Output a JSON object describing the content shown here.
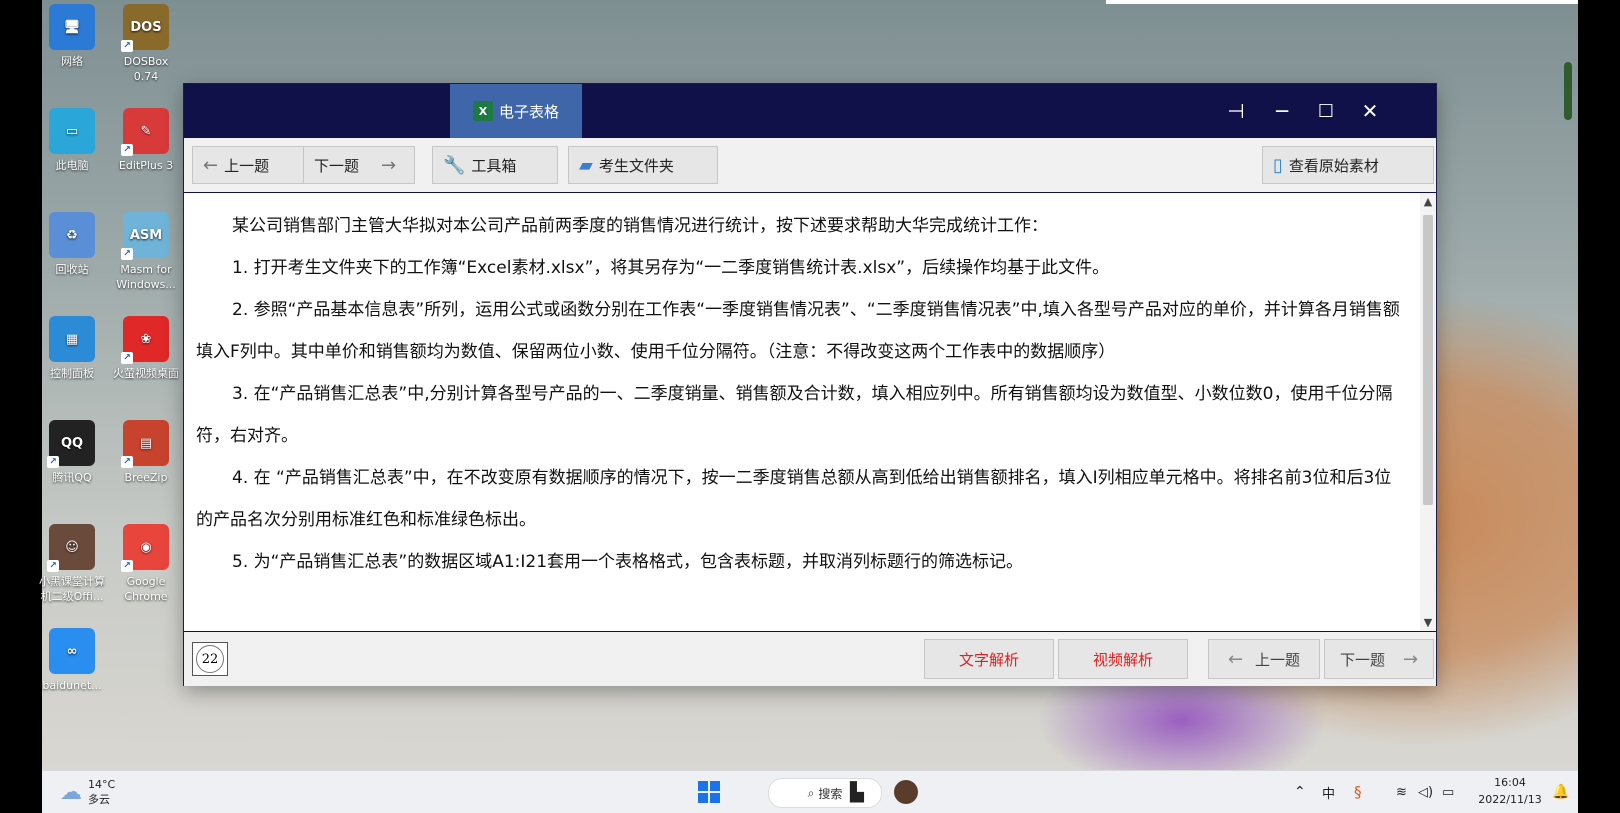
{
  "desktop": {
    "icons": [
      {
        "label": "网络",
        "glyph": "🖥",
        "color": "#2b7bd6"
      },
      {
        "label": "DOSBox 0.74",
        "glyph": "DOS",
        "color": "#8a6a2a"
      },
      {
        "label": "此电脑",
        "glyph": "▭",
        "color": "#2aa7d8"
      },
      {
        "label": "EditPlus 3",
        "glyph": "✎",
        "color": "#d83a3a"
      },
      {
        "label": "回收站",
        "glyph": "♻",
        "color": "#5a8ed6"
      },
      {
        "label": "Masm for Windows...",
        "glyph": "ASM",
        "color": "#6fb4d8"
      },
      {
        "label": "控制面板",
        "glyph": "▦",
        "color": "#2c8bd6"
      },
      {
        "label": "火萤视频桌面",
        "glyph": "❀",
        "color": "#e02828"
      },
      {
        "label": "腾讯QQ",
        "glyph": "QQ",
        "color": "#222222"
      },
      {
        "label": "BreeZip",
        "glyph": "▤",
        "color": "#c8432d"
      },
      {
        "label": "小黑课堂计算机二级Offi...",
        "glyph": "☺",
        "color": "#6a4a3a"
      },
      {
        "label": "Google Chrome",
        "glyph": "◉",
        "color": "#e8453c"
      },
      {
        "label": "baidunet...",
        "glyph": "∞",
        "color": "#2a8ef0"
      }
    ]
  },
  "window": {
    "tab_title": "电子表格",
    "tab_icon": "X",
    "controls": {
      "pin": "⊣",
      "minimize": "─",
      "maximize": "☐",
      "close": "✕"
    }
  },
  "toolbar": {
    "prev_label": "上一题",
    "next_label": "下一题",
    "tools_label": "工具箱",
    "folder_label": "考生文件夹",
    "view_material_label": "查看原始素材"
  },
  "question": {
    "paragraphs": [
      "某公司销售部门主管大华拟对本公司产品前两季度的销售情况进行统计，按下述要求帮助大华完成统计工作：",
      "1. 打开考生文件夹下的工作簿“Excel素材.xlsx”，将其另存为“一二季度销售统计表.xlsx”，后续操作均基于此文件。",
      "2. 参照“产品基本信息表”所列，运用公式或函数分别在工作表“一季度销售情况表”、“二季度销售情况表”中,填入各型号产品对应的单价，并计算各月销售额填入F列中。其中单价和销售额均为数值、保留两位小数、使用千位分隔符。（注意：不得改变这两个工作表中的数据顺序）",
      "3. 在“产品销售汇总表”中,分别计算各型号产品的一、二季度销量、销售额及合计数，填入相应列中。所有销售额均设为数值型、小数位数0，使用千位分隔符，右对齐。",
      "4. 在 “产品销售汇总表”中，在不改变原有数据顺序的情况下，按一二季度销售总额从高到低给出销售额排名，填入I列相应单元格中。将排名前3位和后3位的产品名次分别用标准红色和标准绿色标出。",
      "5. 为“产品销售汇总表”的数据区域A1:I21套用一个表格格式，包含表标题，并取消列标题行的筛选标记。"
    ]
  },
  "bottombar": {
    "question_number": "22",
    "text_analysis_label": "文字解析",
    "video_analysis_label": "视频解析",
    "prev_label": "上一题",
    "next_label": "下一题"
  },
  "taskbar": {
    "weather_temp": "14°C",
    "weather_desc": "多云",
    "search_label": "搜索",
    "tray_ime": "中",
    "time": "16:04",
    "date": "2022/11/13"
  },
  "colors": {
    "titlebar": "#11114a",
    "tab_active": "#3f66a8",
    "analysis_text": "#e02020"
  }
}
